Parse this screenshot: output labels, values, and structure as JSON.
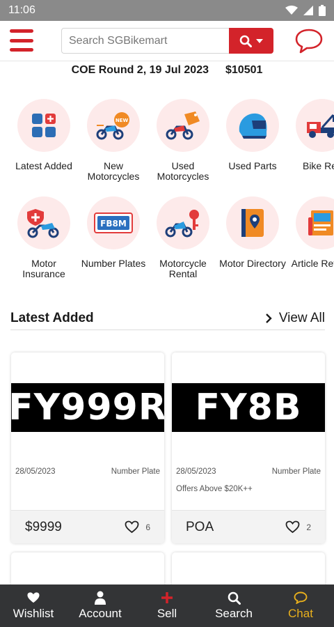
{
  "status": {
    "time": "11:06"
  },
  "search": {
    "placeholder": "Search SGBikemart"
  },
  "coe": {
    "round": "COE Round 2, 19 Jul 2023",
    "price": "$10501"
  },
  "categories": [
    {
      "label": "Latest Added",
      "icon": "grid-icon"
    },
    {
      "label": "New Motorcycles",
      "icon": "new-motorcycle-icon"
    },
    {
      "label": "Used Motorcycles",
      "icon": "used-motorcycle-icon"
    },
    {
      "label": "Used Parts",
      "icon": "helmet-icon"
    },
    {
      "label": "Bike Res",
      "icon": "tow-truck-icon"
    },
    {
      "label": "Motor Insurance",
      "icon": "insurance-icon"
    },
    {
      "label": "Number Plates",
      "icon": "number-plate-icon"
    },
    {
      "label": "Motorcycle Rental",
      "icon": "rental-key-icon"
    },
    {
      "label": "Motor Directory",
      "icon": "directory-book-icon"
    },
    {
      "label": "Article Review",
      "icon": "article-icon"
    }
  ],
  "categories_plate_text": "FB8M",
  "section": {
    "title": "Latest Added",
    "view_all": "View All"
  },
  "listings": [
    {
      "plate": "FY999R",
      "date": "28/05/2023",
      "category": "Number Plate",
      "note": "",
      "price": "$9999",
      "likes": "6"
    },
    {
      "plate": "FY8B",
      "date": "28/05/2023",
      "category": "Number Plate",
      "note": "Offers Above $20K++",
      "price": "POA",
      "likes": "2"
    }
  ],
  "nav": [
    {
      "label": "Wishlist",
      "icon": "heart-icon"
    },
    {
      "label": "Account",
      "icon": "person-icon"
    },
    {
      "label": "Sell",
      "icon": "plus-icon"
    },
    {
      "label": "Search",
      "icon": "search-icon"
    },
    {
      "label": "Chat",
      "icon": "chat-icon"
    }
  ],
  "colors": {
    "brand_red": "#d3232a",
    "active_nav": "#e9b01c",
    "nav_bg": "#333436",
    "icon_bg": "#fdeaea"
  }
}
